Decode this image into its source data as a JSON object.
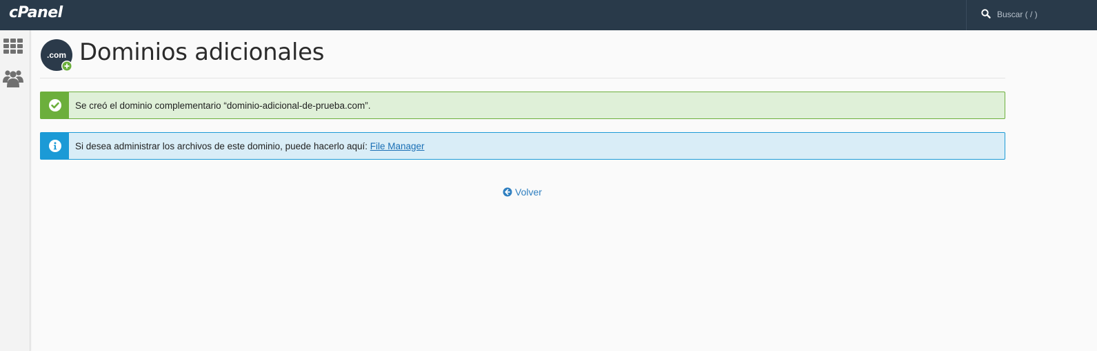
{
  "topbar": {
    "logo_text": "cPanel",
    "search_placeholder": "Buscar ( / )"
  },
  "sidebar": {
    "items": [
      {
        "name": "grid-apps",
        "icon": "grid-icon"
      },
      {
        "name": "users",
        "icon": "users-icon"
      }
    ]
  },
  "page": {
    "title": "Dominios adicionales",
    "icon_text": ".com",
    "icon_badge": "+"
  },
  "alerts": {
    "success": {
      "message": "Se creó el dominio complementario “dominio-adicional-de-prueba.com”.",
      "icon": "check-circle-icon",
      "color": "#6caf3c"
    },
    "info": {
      "message": "Si desea administrar los archivos de este dominio, puede hacerlo aquí: ",
      "link_text": "File Manager",
      "icon": "info-circle-icon",
      "color": "#1b9ad6"
    }
  },
  "back": {
    "label": "Volver",
    "icon": "arrow-circle-left-icon"
  },
  "colors": {
    "topbar": "#293a4a",
    "link": "#2f7fc0"
  }
}
